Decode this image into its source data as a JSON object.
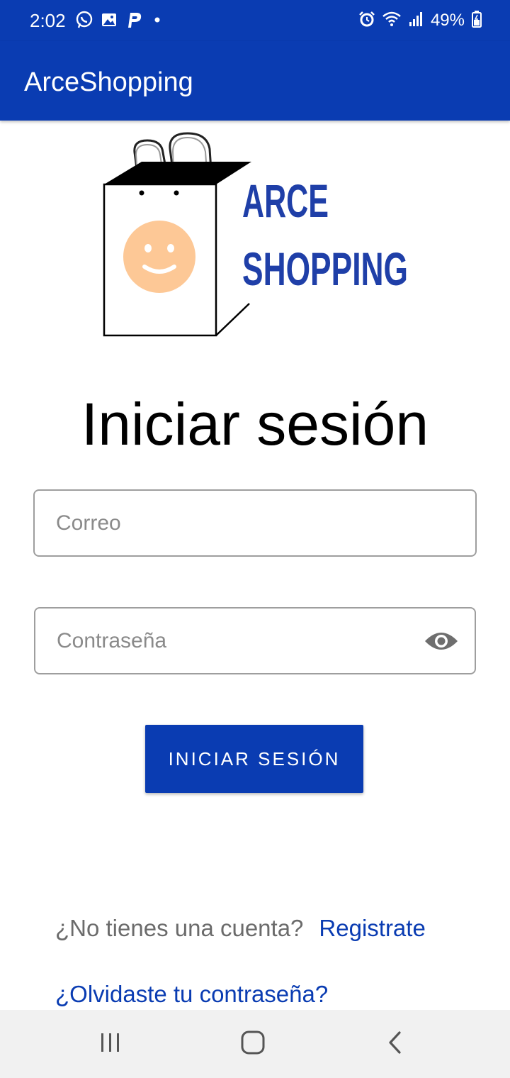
{
  "status_bar": {
    "time": "2:02",
    "battery": "49%",
    "left_icons": [
      "whatsapp-icon",
      "gallery-icon",
      "parking-app-icon",
      "notification-dot-icon"
    ],
    "right_icons": [
      "alarm-icon",
      "wifi-icon",
      "signal-icon",
      "battery-icon"
    ]
  },
  "app_bar": {
    "title": "ArceShopping"
  },
  "logo": {
    "line1": "ARCE",
    "line2": "SHOPPING"
  },
  "login": {
    "title": "Iniciar sesión",
    "email_placeholder": "Correo",
    "email_value": "",
    "password_placeholder": "Contraseña",
    "password_value": "",
    "submit_label": "INICIAR SESIÓN"
  },
  "links": {
    "no_account_text": "¿No tienes una cuenta?",
    "register_label": "Registrate",
    "forgot_password_label": "¿Olvidaste tu contraseña?"
  },
  "nav_bar": {
    "buttons": [
      "recent-apps-icon",
      "home-icon",
      "back-icon"
    ]
  },
  "colors": {
    "primary": "#0a3cb2",
    "logo_text": "#1f3fa8",
    "smiley": "#fdc896",
    "placeholder": "#8a8a8a",
    "nav_background": "#f1f1f1"
  }
}
